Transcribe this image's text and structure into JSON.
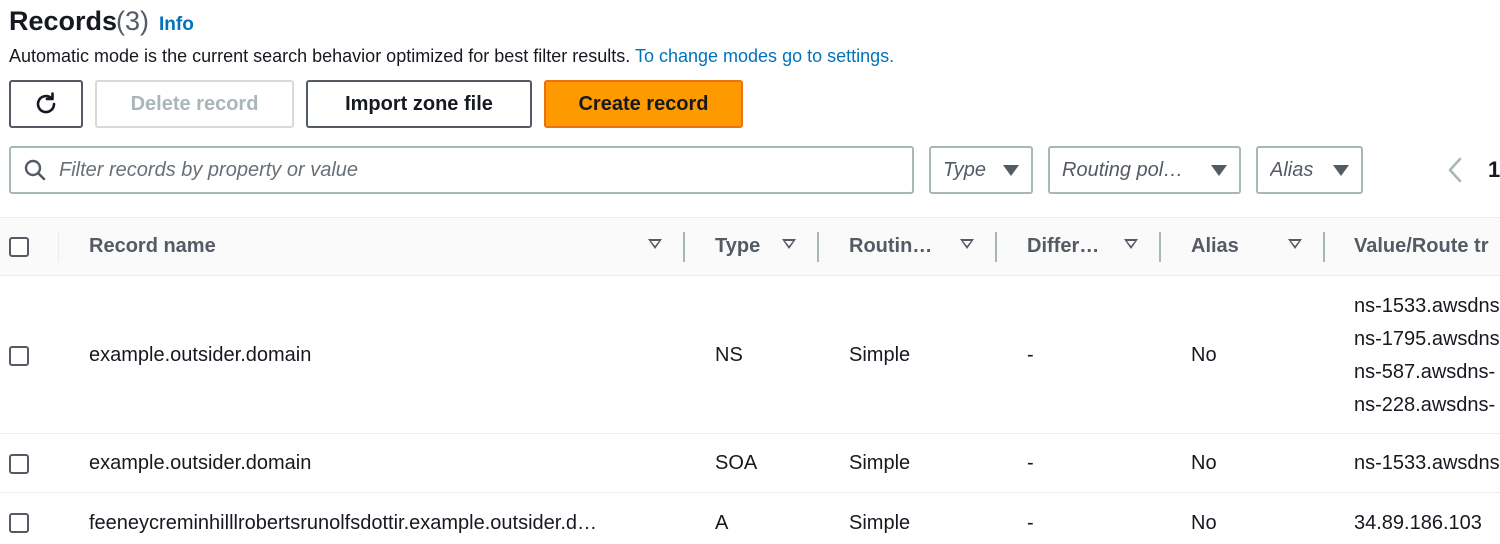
{
  "header": {
    "title": "Records",
    "count": "(3)",
    "info_link": "Info",
    "description": "Automatic mode is the current search behavior optimized for best filter results.",
    "description_link": "To change modes go to settings."
  },
  "toolbar": {
    "refresh_icon": "refresh-icon",
    "delete_label": "Delete record",
    "import_label": "Import zone file",
    "create_label": "Create record",
    "create_color": "#ff9900"
  },
  "filters": {
    "search_placeholder": "Filter records by property or value",
    "type_label": "Type",
    "routing_label": "Routing pol…",
    "alias_label": "Alias",
    "page_number": "1"
  },
  "table": {
    "columns": [
      "Record name",
      "Type",
      "Routin…",
      "Differ…",
      "Alias",
      "Value/Route tr"
    ],
    "rows": [
      {
        "name": "example.outsider.domain",
        "type": "NS",
        "routing": "Simple",
        "differentiator": "-",
        "alias": "No",
        "values": [
          "ns-1533.awsdns",
          "ns-1795.awsdns",
          "ns-587.awsdns-",
          "ns-228.awsdns-"
        ]
      },
      {
        "name": "example.outsider.domain",
        "type": "SOA",
        "routing": "Simple",
        "differentiator": "-",
        "alias": "No",
        "values": [
          "ns-1533.awsdns"
        ]
      },
      {
        "name": "feeneycreminhilllrobertsrunolfsdottir.example.outsider.d…",
        "type": "A",
        "routing": "Simple",
        "differentiator": "-",
        "alias": "No",
        "values": [
          "34.89.186.103"
        ]
      }
    ]
  }
}
